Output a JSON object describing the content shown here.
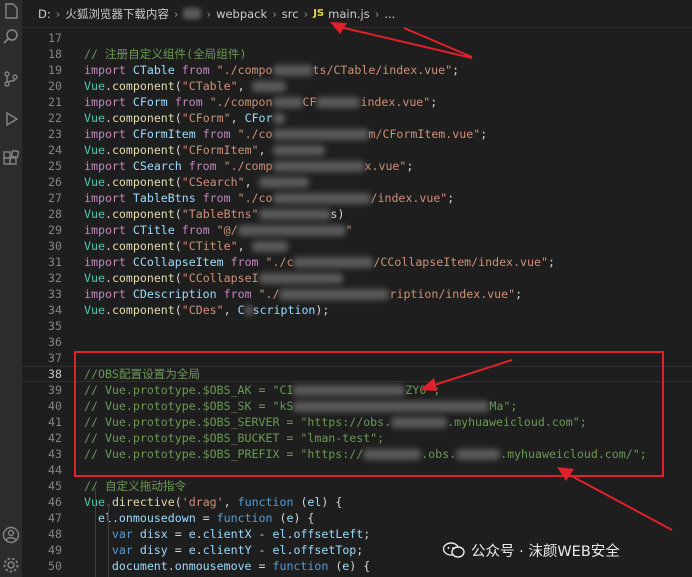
{
  "breadcrumb": {
    "drive": "D:",
    "folder": "火狐浏览器下载内容",
    "p2": "webpack",
    "p3": "src",
    "file_icon": "JS",
    "file": "main.js",
    "tail": "..."
  },
  "lines": [
    {
      "num": "17",
      "tokens": []
    },
    {
      "num": "18",
      "tokens": [
        {
          "c": "c",
          "t": "// 注册自定义组件(全局组件)"
        }
      ]
    },
    {
      "num": "19",
      "tokens": [
        {
          "c": "k",
          "t": "import "
        },
        {
          "c": "v",
          "t": "CTable "
        },
        {
          "c": "k",
          "t": "from "
        },
        {
          "c": "s",
          "t": "\"./compo"
        },
        {
          "b": 40
        },
        {
          "c": "s",
          "t": "ts/CTable/index.vue\""
        },
        {
          "c": "p",
          "t": ";"
        }
      ]
    },
    {
      "num": "20",
      "tokens": [
        {
          "c": "t",
          "t": "Vue"
        },
        {
          "c": "p",
          "t": "."
        },
        {
          "c": "f",
          "t": "component"
        },
        {
          "c": "p",
          "t": "("
        },
        {
          "c": "s",
          "t": "\"CTable\""
        },
        {
          "c": "p",
          "t": ", "
        },
        {
          "b": 34
        }
      ]
    },
    {
      "num": "21",
      "tokens": [
        {
          "c": "k",
          "t": "import "
        },
        {
          "c": "v",
          "t": "CForm "
        },
        {
          "c": "k",
          "t": "from "
        },
        {
          "c": "s",
          "t": "\"./compon"
        },
        {
          "b": 30
        },
        {
          "c": "s",
          "t": "CF"
        },
        {
          "b": 44
        },
        {
          "c": "s",
          "t": "index.vue\""
        },
        {
          "c": "p",
          "t": ";"
        }
      ]
    },
    {
      "num": "22",
      "tokens": [
        {
          "c": "t",
          "t": "Vue"
        },
        {
          "c": "p",
          "t": "."
        },
        {
          "c": "f",
          "t": "component"
        },
        {
          "c": "p",
          "t": "("
        },
        {
          "c": "s",
          "t": "\"CForm\""
        },
        {
          "c": "p",
          "t": ", "
        },
        {
          "c": "v",
          "t": "CFor"
        },
        {
          "b": 12
        }
      ]
    },
    {
      "num": "23",
      "tokens": [
        {
          "c": "k",
          "t": "import "
        },
        {
          "c": "v",
          "t": "CFormItem "
        },
        {
          "c": "k",
          "t": "from "
        },
        {
          "c": "s",
          "t": "\"./co"
        },
        {
          "b": 96
        },
        {
          "c": "s",
          "t": "m/CFormItem.vue\""
        },
        {
          "c": "p",
          "t": ";"
        }
      ]
    },
    {
      "num": "24",
      "tokens": [
        {
          "c": "t",
          "t": "Vue"
        },
        {
          "c": "p",
          "t": "."
        },
        {
          "c": "f",
          "t": "component"
        },
        {
          "c": "p",
          "t": "("
        },
        {
          "c": "s",
          "t": "\"CFormItem\""
        },
        {
          "c": "p",
          "t": ", "
        },
        {
          "b": 52
        }
      ]
    },
    {
      "num": "25",
      "tokens": [
        {
          "c": "k",
          "t": "import "
        },
        {
          "c": "v",
          "t": "CSearch "
        },
        {
          "c": "k",
          "t": "from "
        },
        {
          "c": "s",
          "t": "\"./comp"
        },
        {
          "b": 92
        },
        {
          "c": "s",
          "t": "x.vue\""
        },
        {
          "c": "p",
          "t": ";"
        }
      ]
    },
    {
      "num": "26",
      "tokens": [
        {
          "c": "t",
          "t": "Vue"
        },
        {
          "c": "p",
          "t": "."
        },
        {
          "c": "f",
          "t": "component"
        },
        {
          "c": "p",
          "t": "("
        },
        {
          "c": "s",
          "t": "\"CSearch\""
        },
        {
          "c": "p",
          "t": ", "
        },
        {
          "b": 50
        }
      ]
    },
    {
      "num": "27",
      "tokens": [
        {
          "c": "k",
          "t": "import "
        },
        {
          "c": "v",
          "t": "TableBtns "
        },
        {
          "c": "k",
          "t": "from "
        },
        {
          "c": "s",
          "t": "\"./co"
        },
        {
          "b": 98
        },
        {
          "c": "s",
          "t": "/index.vue\""
        },
        {
          "c": "p",
          "t": ";"
        }
      ]
    },
    {
      "num": "28",
      "tokens": [
        {
          "c": "t",
          "t": "Vue"
        },
        {
          "c": "p",
          "t": "."
        },
        {
          "c": "f",
          "t": "component"
        },
        {
          "c": "p",
          "t": "("
        },
        {
          "c": "s",
          "t": "\"TableBtns\""
        },
        {
          "b": 72
        },
        {
          "c": "p",
          "t": "s)"
        }
      ]
    },
    {
      "num": "29",
      "tokens": [
        {
          "c": "k",
          "t": "import "
        },
        {
          "c": "v",
          "t": "CTitle "
        },
        {
          "c": "k",
          "t": "from "
        },
        {
          "c": "s",
          "t": "\"@/"
        },
        {
          "b": 108
        },
        {
          "c": "s",
          "t": "\""
        }
      ]
    },
    {
      "num": "30",
      "tokens": [
        {
          "c": "t",
          "t": "Vue"
        },
        {
          "c": "p",
          "t": "."
        },
        {
          "c": "f",
          "t": "component"
        },
        {
          "c": "p",
          "t": "("
        },
        {
          "c": "s",
          "t": "\"CTitle\""
        },
        {
          "c": "p",
          "t": ", "
        },
        {
          "b": 36
        }
      ]
    },
    {
      "num": "31",
      "tokens": [
        {
          "c": "k",
          "t": "import "
        },
        {
          "c": "v",
          "t": "CCollapseItem "
        },
        {
          "c": "k",
          "t": "from "
        },
        {
          "c": "s",
          "t": "\"./c"
        },
        {
          "b": 80
        },
        {
          "c": "s",
          "t": "/CCollapseItem/index.vue\""
        },
        {
          "c": "p",
          "t": ";"
        }
      ]
    },
    {
      "num": "32",
      "tokens": [
        {
          "c": "t",
          "t": "Vue"
        },
        {
          "c": "p",
          "t": "."
        },
        {
          "c": "f",
          "t": "component"
        },
        {
          "c": "p",
          "t": "("
        },
        {
          "c": "s",
          "t": "\"CCollapseI"
        },
        {
          "b": 84
        }
      ]
    },
    {
      "num": "33",
      "tokens": [
        {
          "c": "k",
          "t": "import "
        },
        {
          "c": "v",
          "t": "CDescription "
        },
        {
          "c": "k",
          "t": "from "
        },
        {
          "c": "s",
          "t": "\"./"
        },
        {
          "b": 110
        },
        {
          "c": "s",
          "t": "ription/index.vue\""
        },
        {
          "c": "p",
          "t": ";"
        }
      ]
    },
    {
      "num": "34",
      "tokens": [
        {
          "c": "t",
          "t": "Vue"
        },
        {
          "c": "p",
          "t": "."
        },
        {
          "c": "f",
          "t": "component"
        },
        {
          "c": "p",
          "t": "("
        },
        {
          "c": "s",
          "t": "\"CDes\""
        },
        {
          "c": "p",
          "t": ", "
        },
        {
          "c": "v",
          "t": "C"
        },
        {
          "b": 8
        },
        {
          "c": "v",
          "t": "scription"
        },
        {
          "c": "p",
          "t": ");"
        }
      ]
    },
    {
      "num": "35",
      "tokens": []
    },
    {
      "num": "36",
      "tokens": []
    },
    {
      "num": "37",
      "tokens": []
    },
    {
      "num": "38",
      "active": true,
      "tokens": [
        {
          "c": "c",
          "t": "//OBS配置设置为全局"
        }
      ]
    },
    {
      "num": "39",
      "tokens": [
        {
          "c": "c",
          "t": "// Vue.prototype.$OBS_AK = \"CI"
        },
        {
          "b": 112
        },
        {
          "c": "c",
          "t": "ZY0\";"
        }
      ]
    },
    {
      "num": "40",
      "tokens": [
        {
          "c": "c",
          "t": "// Vue.prototype.$OBS_SK = \"kS"
        },
        {
          "b": 196
        },
        {
          "c": "c",
          "t": "Ma\";"
        }
      ]
    },
    {
      "num": "41",
      "tokens": [
        {
          "c": "c",
          "t": "// Vue.prototype.$OBS_SERVER = \"https://obs."
        },
        {
          "b": 56
        },
        {
          "c": "c",
          "t": ".myhuaweicloud.com\";"
        }
      ]
    },
    {
      "num": "42",
      "tokens": [
        {
          "c": "c",
          "t": "// Vue.prototype.$OBS_BUCKET = \"lman-test\";"
        }
      ]
    },
    {
      "num": "43",
      "tokens": [
        {
          "c": "c",
          "t": "// Vue.prototype.$OBS_PREFIX = \"https://"
        },
        {
          "b": 58
        },
        {
          "c": "c",
          "t": ".obs."
        },
        {
          "b": 44
        },
        {
          "c": "c",
          "t": ".myhuaweicloud.com/\";"
        }
      ]
    },
    {
      "num": "44",
      "tokens": []
    },
    {
      "num": "45",
      "tokens": [
        {
          "c": "c",
          "t": "// 自定义拖动指令"
        }
      ]
    },
    {
      "num": "46",
      "tokens": [
        {
          "c": "t",
          "t": "Vue"
        },
        {
          "c": "p",
          "t": "."
        },
        {
          "c": "f",
          "t": "directive"
        },
        {
          "c": "p",
          "t": "("
        },
        {
          "c": "s",
          "t": "'drag'"
        },
        {
          "c": "p",
          "t": ", "
        },
        {
          "c": "k2",
          "t": "function "
        },
        {
          "c": "p",
          "t": "("
        },
        {
          "c": "v",
          "t": "el"
        },
        {
          "c": "p",
          "t": ") {"
        }
      ]
    },
    {
      "num": "47",
      "tokens": [
        {
          "c": "p",
          "t": "  "
        },
        {
          "c": "v",
          "t": "el"
        },
        {
          "c": "p",
          "t": "."
        },
        {
          "c": "v",
          "t": "onmousedown"
        },
        {
          "c": "p",
          "t": " = "
        },
        {
          "c": "k2",
          "t": "function "
        },
        {
          "c": "p",
          "t": "("
        },
        {
          "c": "v",
          "t": "e"
        },
        {
          "c": "p",
          "t": ") {"
        }
      ]
    },
    {
      "num": "48",
      "tokens": [
        {
          "c": "p",
          "t": "    "
        },
        {
          "c": "k2",
          "t": "var "
        },
        {
          "c": "v",
          "t": "disx"
        },
        {
          "c": "p",
          "t": " = "
        },
        {
          "c": "v",
          "t": "e"
        },
        {
          "c": "p",
          "t": "."
        },
        {
          "c": "v",
          "t": "clientX"
        },
        {
          "c": "p",
          "t": " - "
        },
        {
          "c": "v",
          "t": "el"
        },
        {
          "c": "p",
          "t": "."
        },
        {
          "c": "v",
          "t": "offsetLeft"
        },
        {
          "c": "p",
          "t": ";"
        }
      ]
    },
    {
      "num": "49",
      "tokens": [
        {
          "c": "p",
          "t": "    "
        },
        {
          "c": "k2",
          "t": "var "
        },
        {
          "c": "v",
          "t": "disy"
        },
        {
          "c": "p",
          "t": " = "
        },
        {
          "c": "v",
          "t": "e"
        },
        {
          "c": "p",
          "t": "."
        },
        {
          "c": "v",
          "t": "clientY"
        },
        {
          "c": "p",
          "t": " - "
        },
        {
          "c": "v",
          "t": "el"
        },
        {
          "c": "p",
          "t": "."
        },
        {
          "c": "v",
          "t": "offsetTop"
        },
        {
          "c": "p",
          "t": ";"
        }
      ]
    },
    {
      "num": "50",
      "tokens": [
        {
          "c": "p",
          "t": "    "
        },
        {
          "c": "v",
          "t": "document"
        },
        {
          "c": "p",
          "t": "."
        },
        {
          "c": "v",
          "t": "onmousemove"
        },
        {
          "c": "p",
          "t": " = "
        },
        {
          "c": "k2",
          "t": "function "
        },
        {
          "c": "p",
          "t": "("
        },
        {
          "c": "v",
          "t": "e"
        },
        {
          "c": "p",
          "t": ") {"
        }
      ]
    }
  ],
  "watermark": {
    "text": "公众号 · 沫颜WEB安全",
    "icon": "wechat-icon"
  },
  "colors": {
    "background": "#1e1e1e",
    "highlight": "#e0202a",
    "comment": "#6a9955",
    "string": "#ce9178",
    "keyword": "#c586c0"
  },
  "icons": [
    "explorer-icon",
    "search-icon",
    "source-control-icon",
    "run-debug-icon",
    "extensions-icon",
    "account-icon",
    "settings-icon"
  ]
}
